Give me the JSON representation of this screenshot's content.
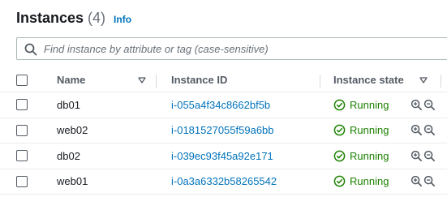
{
  "header": {
    "title": "Instances",
    "count": "(4)",
    "info_label": "Info"
  },
  "search": {
    "placeholder": "Find instance by attribute or tag (case-sensitive)"
  },
  "table": {
    "columns": {
      "name": "Name",
      "instance_id": "Instance ID",
      "state": "Instance state"
    },
    "rows": [
      {
        "name": "db01",
        "instance_id": "i-055a4f34c8662bf5b",
        "state": "Running"
      },
      {
        "name": "web02",
        "instance_id": "i-0181527055f59a6bb",
        "state": "Running"
      },
      {
        "name": "db02",
        "instance_id": "i-039ec93f45a92e171",
        "state": "Running"
      },
      {
        "name": "web01",
        "instance_id": "i-0a3a6332b58265542",
        "state": "Running"
      }
    ]
  },
  "colors": {
    "link": "#0073bb",
    "running": "#1d8102",
    "border": "#eaeded"
  }
}
